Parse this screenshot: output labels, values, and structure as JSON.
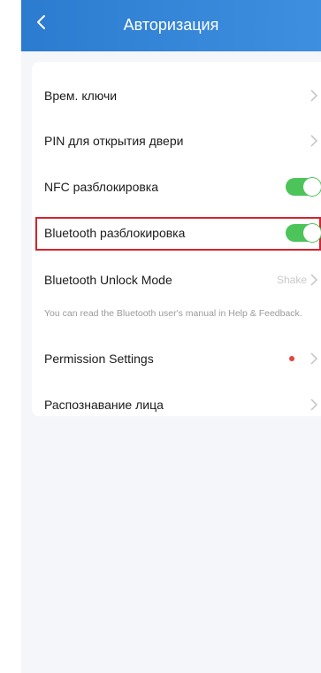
{
  "header": {
    "title": "Авторизация",
    "background_color": "#2b7bd0"
  },
  "settings": {
    "temp_keys": {
      "label": "Врем. ключи"
    },
    "door_pin": {
      "label": "PIN для открытия двери"
    },
    "nfc_unlock": {
      "label": "NFC разблокировка",
      "enabled": true
    },
    "bluetooth_unlock": {
      "label": "Bluetooth разблокировка",
      "enabled": true,
      "highlighted": true
    },
    "bluetooth_mode": {
      "label": "Bluetooth Unlock Mode",
      "value": "Shake",
      "hint": "You can read the Bluetooth user's manual in Help & Feedback."
    },
    "permission_settings": {
      "label": "Permission Settings",
      "notification_dot": true
    },
    "face_recognition": {
      "label": "Распознавание лица"
    }
  },
  "colors": {
    "accent": "#2b7bd0",
    "toggle_on": "#4cc45a",
    "highlight_border": "#d2242e",
    "notification_dot": "#e3433e"
  }
}
